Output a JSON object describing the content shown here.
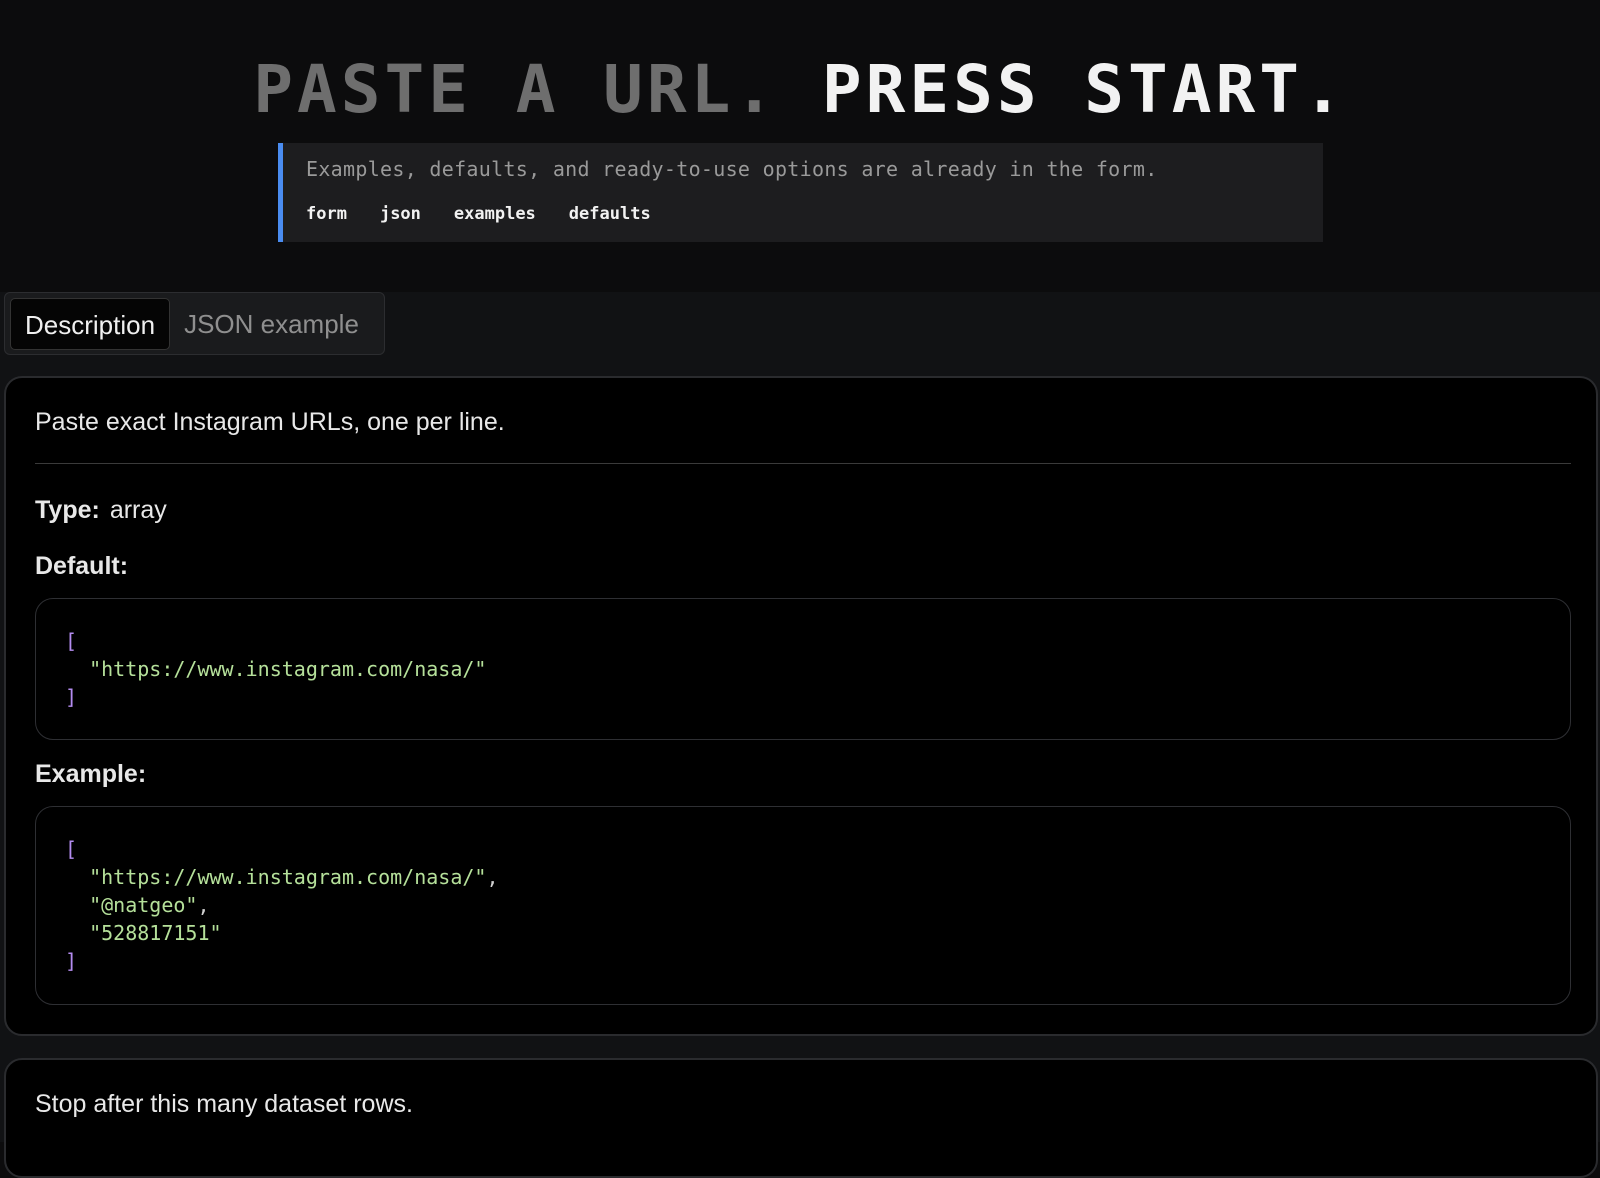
{
  "hero": {
    "title_dim": "PASTE A URL.",
    "title_bright": "PRESS START.",
    "callout_text": "Examples, defaults, and ready-to-use options are already in the form.",
    "tags": [
      "form",
      "json",
      "examples",
      "defaults"
    ],
    "accent_color": "#4a8cf0"
  },
  "tabs": {
    "items": [
      {
        "label": "Description",
        "active": true
      },
      {
        "label": "JSON example",
        "active": false
      }
    ]
  },
  "field": {
    "description": "Paste exact Instagram URLs, one per line.",
    "type_label": "Type:",
    "type_value": "array",
    "default_label": "Default:",
    "default_code": {
      "open": "[",
      "items": [
        "\"https://www.instagram.com/nasa/\""
      ],
      "close": "]"
    },
    "example_label": "Example:",
    "example_code": {
      "open": "[",
      "items": [
        "\"https://www.instagram.com/nasa/\"",
        "\"@natgeo\"",
        "\"528817151\""
      ],
      "separators": [
        ",",
        ",",
        ""
      ],
      "close": "]"
    }
  },
  "next_field": {
    "description": "Stop after this many dataset rows."
  }
}
